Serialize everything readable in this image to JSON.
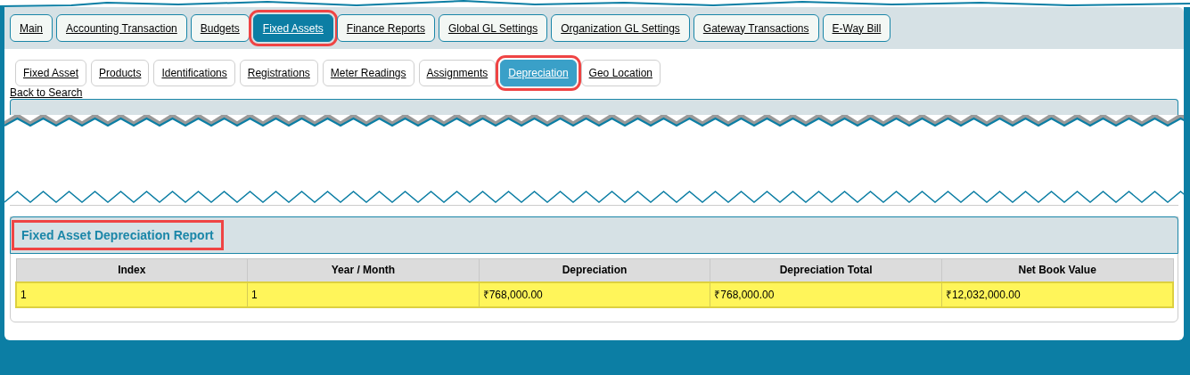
{
  "main_tabs": [
    {
      "label": "Main",
      "selected": false,
      "highlighted": false
    },
    {
      "label": "Accounting Transaction",
      "selected": false,
      "highlighted": false
    },
    {
      "label": "Budgets",
      "selected": false,
      "highlighted": false
    },
    {
      "label": "Fixed Assets",
      "selected": true,
      "highlighted": true
    },
    {
      "label": "Finance Reports",
      "selected": false,
      "highlighted": false
    },
    {
      "label": "Global GL Settings",
      "selected": false,
      "highlighted": false
    },
    {
      "label": "Organization GL Settings",
      "selected": false,
      "highlighted": false
    },
    {
      "label": "Gateway Transactions",
      "selected": false,
      "highlighted": false
    },
    {
      "label": "E-Way Bill",
      "selected": false,
      "highlighted": false
    }
  ],
  "sub_tabs": [
    {
      "label": "Fixed Asset",
      "selected": false,
      "highlighted": false
    },
    {
      "label": "Products",
      "selected": false,
      "highlighted": false
    },
    {
      "label": "Identifications",
      "selected": false,
      "highlighted": false
    },
    {
      "label": "Registrations",
      "selected": false,
      "highlighted": false
    },
    {
      "label": "Meter Readings",
      "selected": false,
      "highlighted": false
    },
    {
      "label": "Assignments",
      "selected": false,
      "highlighted": false
    },
    {
      "label": "Depreciation",
      "selected": true,
      "highlighted": true
    },
    {
      "label": "Geo Location",
      "selected": false,
      "highlighted": false
    }
  ],
  "back_link": "Back to Search",
  "report": {
    "title": "Fixed Asset Depreciation Report",
    "highlighted": true,
    "columns": [
      "Index",
      "Year / Month",
      "Depreciation",
      "Depreciation Total",
      "Net Book Value"
    ],
    "rows": [
      {
        "selected": true,
        "cells": [
          "1",
          "1",
          "₹768,000.00",
          "₹768,000.00",
          "₹12,032,000.00"
        ]
      }
    ]
  }
}
